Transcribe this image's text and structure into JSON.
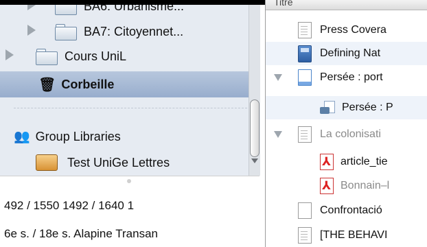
{
  "collections": {
    "items": [
      {
        "label": "BA6: Urbanisme..."
      },
      {
        "label": "BA7: Citoyennet..."
      },
      {
        "label": "Cours UniL"
      },
      {
        "label": "Corbeille"
      },
      {
        "label": "Group Libraries"
      },
      {
        "label": "Test UniGe Lettres"
      }
    ]
  },
  "bottom": {
    "row1": "492 / 1550      1492 / 1640     1",
    "row2": "6e s. / 18e s.    Alapine Transan"
  },
  "items_pane": {
    "header": "Titre",
    "rows": [
      {
        "label": "Press Covera"
      },
      {
        "label": "Defining Nat"
      },
      {
        "label": "Persée : port"
      },
      {
        "label": "Persée : P"
      },
      {
        "label": "La colonisati"
      },
      {
        "label": "article_tie"
      },
      {
        "label": "Bonnain–l"
      },
      {
        "label": "Confrontació"
      },
      {
        "label": "[THE BEHAVI"
      }
    ]
  }
}
